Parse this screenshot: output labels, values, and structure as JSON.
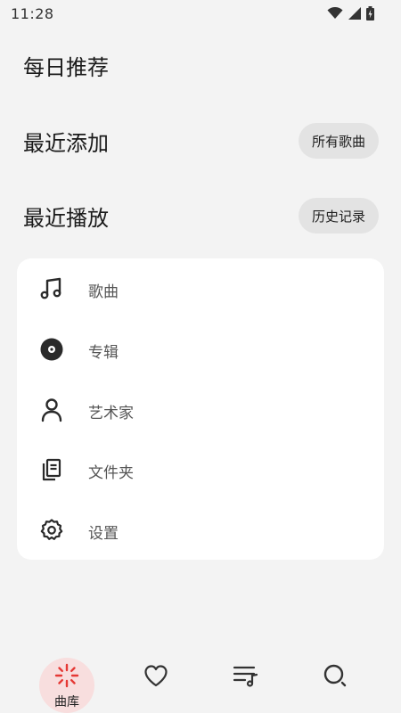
{
  "status_bar": {
    "time": "11:28"
  },
  "sections": [
    {
      "title": "每日推荐",
      "button": ""
    },
    {
      "title": "最近添加",
      "button": "所有歌曲"
    },
    {
      "title": "最近播放",
      "button": "历史记录"
    }
  ],
  "menu": {
    "items": [
      {
        "label": "歌曲",
        "icon": "music-note-icon"
      },
      {
        "label": "专辑",
        "icon": "album-disc-icon"
      },
      {
        "label": "艺术家",
        "icon": "person-icon"
      },
      {
        "label": "文件夹",
        "icon": "folder-copy-icon"
      },
      {
        "label": "设置",
        "icon": "gear-icon"
      }
    ]
  },
  "bottom_nav": {
    "active_label": "曲库",
    "items": [
      {
        "icon": "library-burst-icon",
        "active": true
      },
      {
        "icon": "heart-icon",
        "active": false
      },
      {
        "icon": "playlist-icon",
        "active": false
      },
      {
        "icon": "search-icon",
        "active": false
      }
    ]
  },
  "colors": {
    "background": "#f3f3f3",
    "card": "#ffffff",
    "pill": "#e3e3e3",
    "accent": "#e53935",
    "active_nav_bg": "#f8dede"
  }
}
